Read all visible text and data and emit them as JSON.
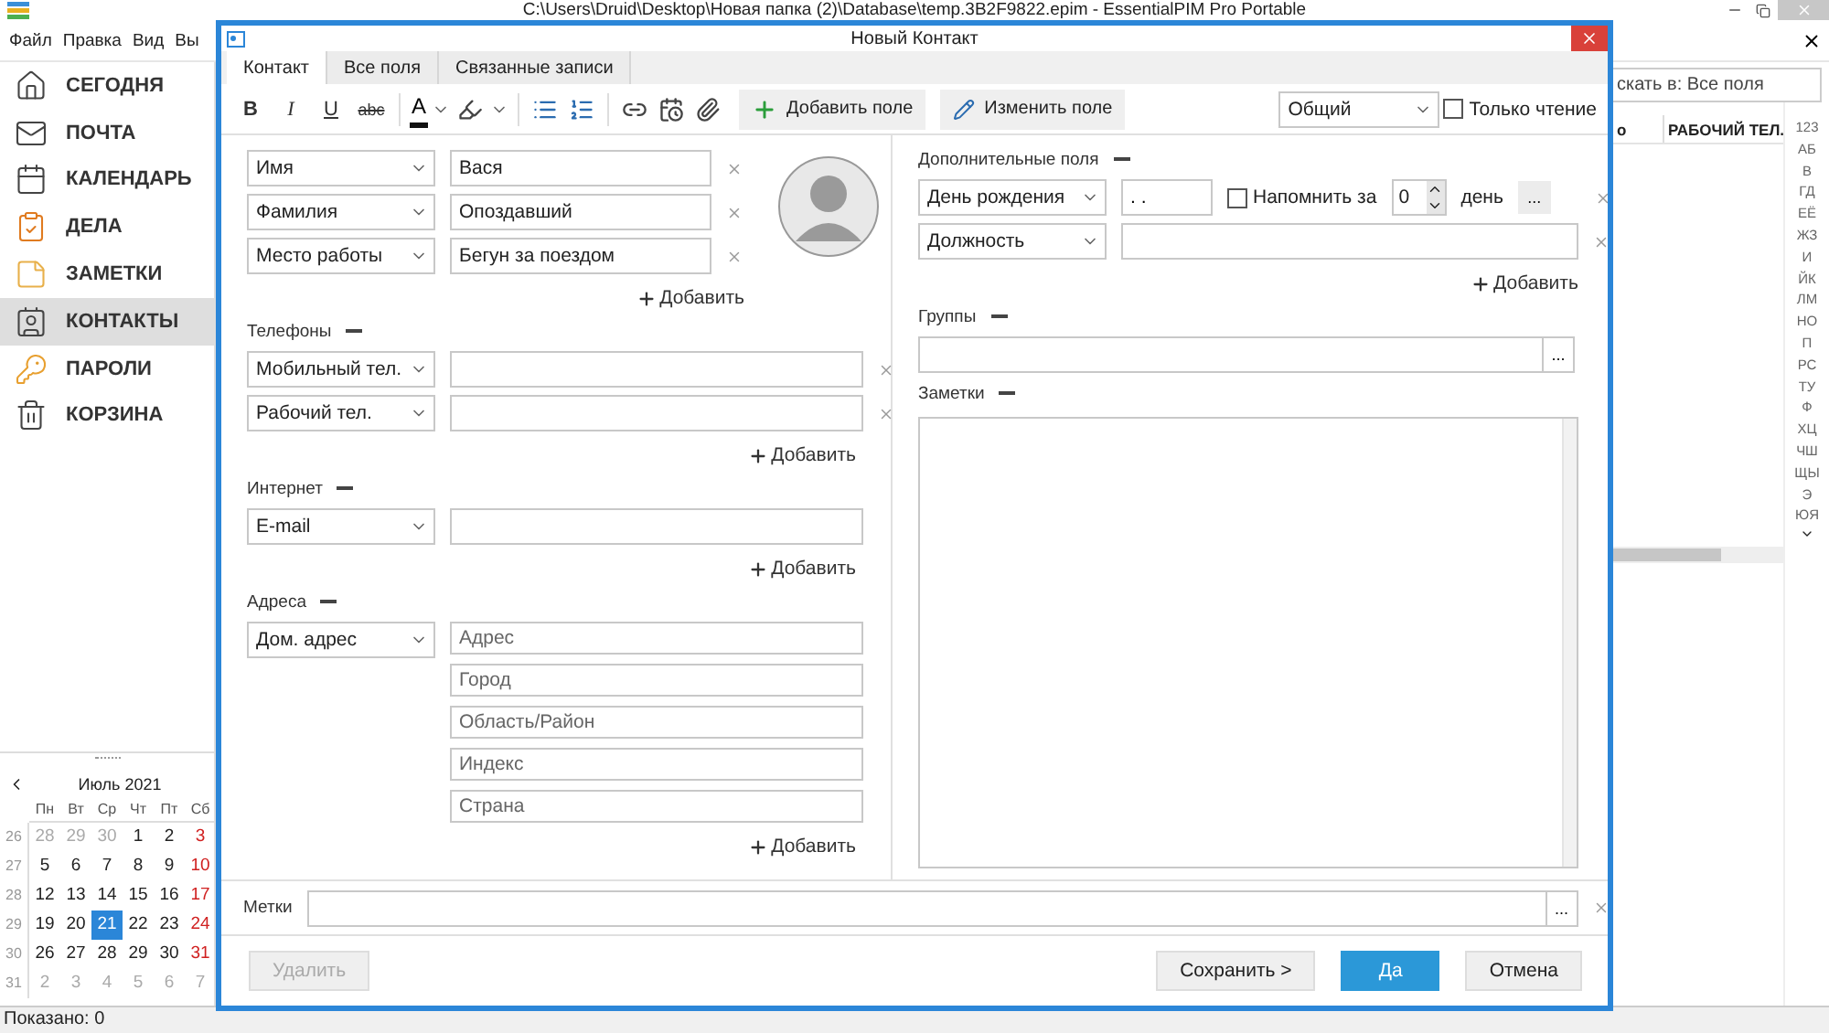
{
  "app": {
    "title": "C:\\Users\\Druid\\Desktop\\Новая папка (2)\\Database\\temp.3B2F9822.epim - EssentialPIM Pro Portable",
    "menu": [
      "Файл",
      "Правка",
      "Вид",
      "Вы"
    ],
    "nav": [
      {
        "label": "СЕГОДНЯ",
        "kind": "today",
        "selected": false
      },
      {
        "label": "ПОЧТА",
        "kind": "mail",
        "selected": false
      },
      {
        "label": "КАЛЕНДАРЬ",
        "kind": "calendar",
        "selected": false
      },
      {
        "label": "ДЕЛА",
        "kind": "tasks",
        "selected": false
      },
      {
        "label": "ЗАМЕТКИ",
        "kind": "notes",
        "selected": false
      },
      {
        "label": "КОНТАКТЫ",
        "kind": "contacts",
        "selected": true
      },
      {
        "label": "ПАРОЛИ",
        "kind": "passwords",
        "selected": false
      },
      {
        "label": "КОРЗИНА",
        "kind": "trash",
        "selected": false
      }
    ],
    "calendar": {
      "month": "Июль 2021",
      "weekdays": [
        "Пн",
        "Вт",
        "Ср",
        "Чт",
        "Пт",
        "Сб"
      ],
      "weeks": [
        {
          "number": "26",
          "days": [
            {
              "day": "28",
              "kind": "other",
              "selected": false
            },
            {
              "day": "29",
              "kind": "other",
              "selected": false
            },
            {
              "day": "30",
              "kind": "other",
              "selected": false
            },
            {
              "day": "1",
              "kind": "day",
              "selected": false
            },
            {
              "day": "2",
              "kind": "day",
              "selected": false
            },
            {
              "day": "3",
              "kind": "weekend",
              "selected": false
            }
          ]
        },
        {
          "number": "27",
          "days": [
            {
              "day": "5",
              "kind": "day",
              "selected": false
            },
            {
              "day": "6",
              "kind": "day",
              "selected": false
            },
            {
              "day": "7",
              "kind": "day",
              "selected": false
            },
            {
              "day": "8",
              "kind": "day",
              "selected": false
            },
            {
              "day": "9",
              "kind": "day",
              "selected": false
            },
            {
              "day": "10",
              "kind": "weekend",
              "selected": false
            }
          ]
        },
        {
          "number": "28",
          "days": [
            {
              "day": "12",
              "kind": "day",
              "selected": false
            },
            {
              "day": "13",
              "kind": "day",
              "selected": false
            },
            {
              "day": "14",
              "kind": "day",
              "selected": false
            },
            {
              "day": "15",
              "kind": "day",
              "selected": false
            },
            {
              "day": "16",
              "kind": "day",
              "selected": false
            },
            {
              "day": "17",
              "kind": "weekend",
              "selected": false
            }
          ]
        },
        {
          "number": "29",
          "days": [
            {
              "day": "19",
              "kind": "day",
              "selected": false
            },
            {
              "day": "20",
              "kind": "day",
              "selected": false
            },
            {
              "day": "21",
              "kind": "day",
              "selected": true
            },
            {
              "day": "22",
              "kind": "day",
              "selected": false
            },
            {
              "day": "23",
              "kind": "day",
              "selected": false
            },
            {
              "day": "24",
              "kind": "weekend",
              "selected": false
            }
          ]
        },
        {
          "number": "30",
          "days": [
            {
              "day": "26",
              "kind": "day",
              "selected": false
            },
            {
              "day": "27",
              "kind": "day",
              "selected": false
            },
            {
              "day": "28",
              "kind": "day",
              "selected": false
            },
            {
              "day": "29",
              "kind": "day",
              "selected": false
            },
            {
              "day": "30",
              "kind": "day",
              "selected": false
            },
            {
              "day": "31",
              "kind": "weekend",
              "selected": false
            }
          ]
        },
        {
          "number": "31",
          "days": [
            {
              "day": "2",
              "kind": "other",
              "selected": false
            },
            {
              "day": "3",
              "kind": "other",
              "selected": false
            },
            {
              "day": "4",
              "kind": "other",
              "selected": false
            },
            {
              "day": "5",
              "kind": "other",
              "selected": false
            },
            {
              "day": "6",
              "kind": "other",
              "selected": false
            },
            {
              "day": "7",
              "kind": "other",
              "selected": false
            }
          ]
        }
      ]
    },
    "search": {
      "placeholder": "скать в: Все поля"
    },
    "columns": [
      "о",
      "РАБОЧИЙ ТЕЛ."
    ],
    "alphabet": [
      "123",
      "АБ",
      "В",
      "ГД",
      "ЕЁ",
      "ЖЗ",
      "И",
      "ЙК",
      "ЛМ",
      "НО",
      "П",
      "РС",
      "ТУ",
      "Ф",
      "ХЦ",
      "ЧШ",
      "ЩЫ",
      "Э",
      "ЮЯ"
    ],
    "status": "Показано: 0"
  },
  "dialog": {
    "title": "Новый Контакт",
    "tabs": [
      {
        "label": "Контакт",
        "selected": true
      },
      {
        "label": "Все поля",
        "selected": false
      },
      {
        "label": "Связанные записи",
        "selected": false
      }
    ],
    "toolbar": {
      "format": [
        {
          "label": "B",
          "kind": "bold"
        },
        {
          "label": "I",
          "kind": "italic"
        },
        {
          "label": "U",
          "kind": "underline"
        },
        {
          "label": "abc",
          "kind": "strike"
        }
      ],
      "font_color": "A",
      "add_field": "Добавить поле",
      "edit_field": "Изменить поле",
      "category": "Общий",
      "readonly": {
        "label": "Только чтение",
        "checked": false
      }
    },
    "name_fields": [
      {
        "type": "Имя",
        "value": "Вася"
      },
      {
        "type": "Фамилия",
        "value": "Опоздавший"
      },
      {
        "type": "Место работы",
        "value": "Бегун за поездом"
      }
    ],
    "name_add": "Добавить",
    "phones": {
      "title": "Телефоны",
      "rows": [
        {
          "type": "Мобильный тел."
        },
        {
          "type": "Рабочий тел."
        }
      ],
      "add": "Добавить"
    },
    "internet": {
      "title": "Интернет",
      "rows": [
        {
          "type": "E-mail"
        }
      ],
      "add": "Добавить"
    },
    "addresses": {
      "title": "Адреса",
      "type": "Дом. адрес",
      "lines": [
        {
          "placeholder": "Адрес"
        },
        {
          "placeholder": "Город"
        },
        {
          "placeholder": "Область/Район"
        },
        {
          "placeholder": "Индекс"
        },
        {
          "placeholder": "Страна"
        }
      ],
      "add": "Добавить"
    },
    "extra": {
      "title": "Дополнительные поля",
      "birthday": {
        "type": "День рождения",
        "date": ". .",
        "remind": {
          "label": "Напомнить за",
          "checked": false
        },
        "days": "0",
        "unit": "день",
        "more": "..."
      },
      "rows": [
        {
          "type": "Должность"
        }
      ],
      "add": "Добавить"
    },
    "groups": {
      "title": "Группы",
      "more": "..."
    },
    "notes": {
      "title": "Заметки"
    },
    "footer": {
      "tags_label": "Метки",
      "tags_more": "...",
      "delete": {
        "label": "Удалить",
        "disabled": true
      },
      "save_more": "Сохранить >",
      "ok": "Да",
      "cancel": "Отмена"
    }
  }
}
